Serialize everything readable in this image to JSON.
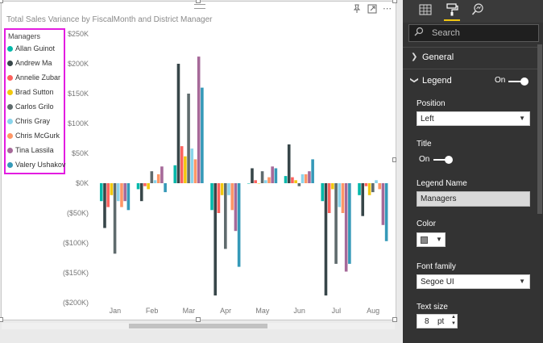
{
  "chart": {
    "title": "Total Sales Variance by FiscalMonth and District Manager",
    "icons": [
      "pin-icon",
      "focus-mode-icon",
      "more-options-icon"
    ]
  },
  "legend": {
    "title": "Managers",
    "items": [
      {
        "name": "Allan Guinot",
        "color": "#01B8AA"
      },
      {
        "name": "Andrew Ma",
        "color": "#374649"
      },
      {
        "name": "Annelie Zubar",
        "color": "#FD625E"
      },
      {
        "name": "Brad Sutton",
        "color": "#F2C80F"
      },
      {
        "name": "Carlos Grilo",
        "color": "#5F6B6D"
      },
      {
        "name": "Chris Gray",
        "color": "#8AD4EB"
      },
      {
        "name": "Chris McGurk",
        "color": "#FE9666"
      },
      {
        "name": "Tina Lassila",
        "color": "#A66999"
      },
      {
        "name": "Valery Ushakov",
        "color": "#3599B8"
      }
    ]
  },
  "chart_data": {
    "type": "bar",
    "title": "Total Sales Variance by FiscalMonth and District Manager",
    "xlabel": "",
    "ylabel": "",
    "ylim": [
      -200000,
      250000
    ],
    "yticks": [
      250000,
      200000,
      150000,
      100000,
      50000,
      0,
      -50000,
      -100000,
      -150000,
      -200000
    ],
    "ytick_labels": [
      "$250K",
      "$200K",
      "$150K",
      "$100K",
      "$50K",
      "$0K",
      "($50K)",
      "($100K)",
      "($150K)",
      "($200K)"
    ],
    "categories": [
      "Jan",
      "Feb",
      "Mar",
      "Apr",
      "May",
      "Jun",
      "Jul",
      "Aug"
    ],
    "legend_position": "left",
    "grid": false,
    "series": [
      {
        "name": "Allan Guinot",
        "values": [
          -30000,
          -10000,
          30000,
          -45000,
          0,
          12000,
          -30000,
          -20000
        ]
      },
      {
        "name": "Andrew Ma",
        "values": [
          -75000,
          -30000,
          200000,
          -188000,
          25000,
          65000,
          -188000,
          -55000
        ]
      },
      {
        "name": "Annelie Zubar",
        "values": [
          -40000,
          -5000,
          62000,
          -50000,
          5000,
          10000,
          -50000,
          -5000
        ]
      },
      {
        "name": "Brad Sutton",
        "values": [
          -20000,
          -10000,
          45000,
          -20000,
          0,
          5000,
          -10000,
          -20000
        ]
      },
      {
        "name": "Carlos Grilo",
        "values": [
          -118000,
          20000,
          150000,
          -110000,
          20000,
          -5000,
          -135000,
          -15000
        ]
      },
      {
        "name": "Chris Gray",
        "values": [
          -30000,
          5000,
          58000,
          -20000,
          5000,
          15000,
          -40000,
          5000
        ]
      },
      {
        "name": "Chris McGurk",
        "values": [
          -40000,
          15000,
          40000,
          -45000,
          10000,
          15000,
          -50000,
          -10000
        ]
      },
      {
        "name": "Tina Lassila",
        "values": [
          -30000,
          28000,
          212000,
          -80000,
          28000,
          20000,
          -148000,
          -70000
        ]
      },
      {
        "name": "Valery Ushakov",
        "values": [
          -45000,
          -15000,
          160000,
          -140000,
          25000,
          40000,
          -135000,
          -97000
        ]
      }
    ]
  },
  "panel": {
    "tabs": [
      {
        "name": "fields-tab",
        "glyph": "▦"
      },
      {
        "name": "format-tab",
        "glyph": "🖌"
      },
      {
        "name": "analytics-tab",
        "glyph": "🔍"
      }
    ],
    "search_placeholder": "Search",
    "sections": {
      "general": "General",
      "legend": "Legend",
      "legend_state": "On"
    },
    "position": {
      "label": "Position",
      "value": "Left"
    },
    "title_toggle": {
      "label": "Title",
      "state": "On"
    },
    "legend_name": {
      "label": "Legend Name",
      "value": "Managers"
    },
    "color": {
      "label": "Color",
      "value": "#888888"
    },
    "font_family": {
      "label": "Font family",
      "value": "Segoe UI"
    },
    "text_size": {
      "label": "Text size",
      "value": "8",
      "unit": "pt"
    }
  }
}
